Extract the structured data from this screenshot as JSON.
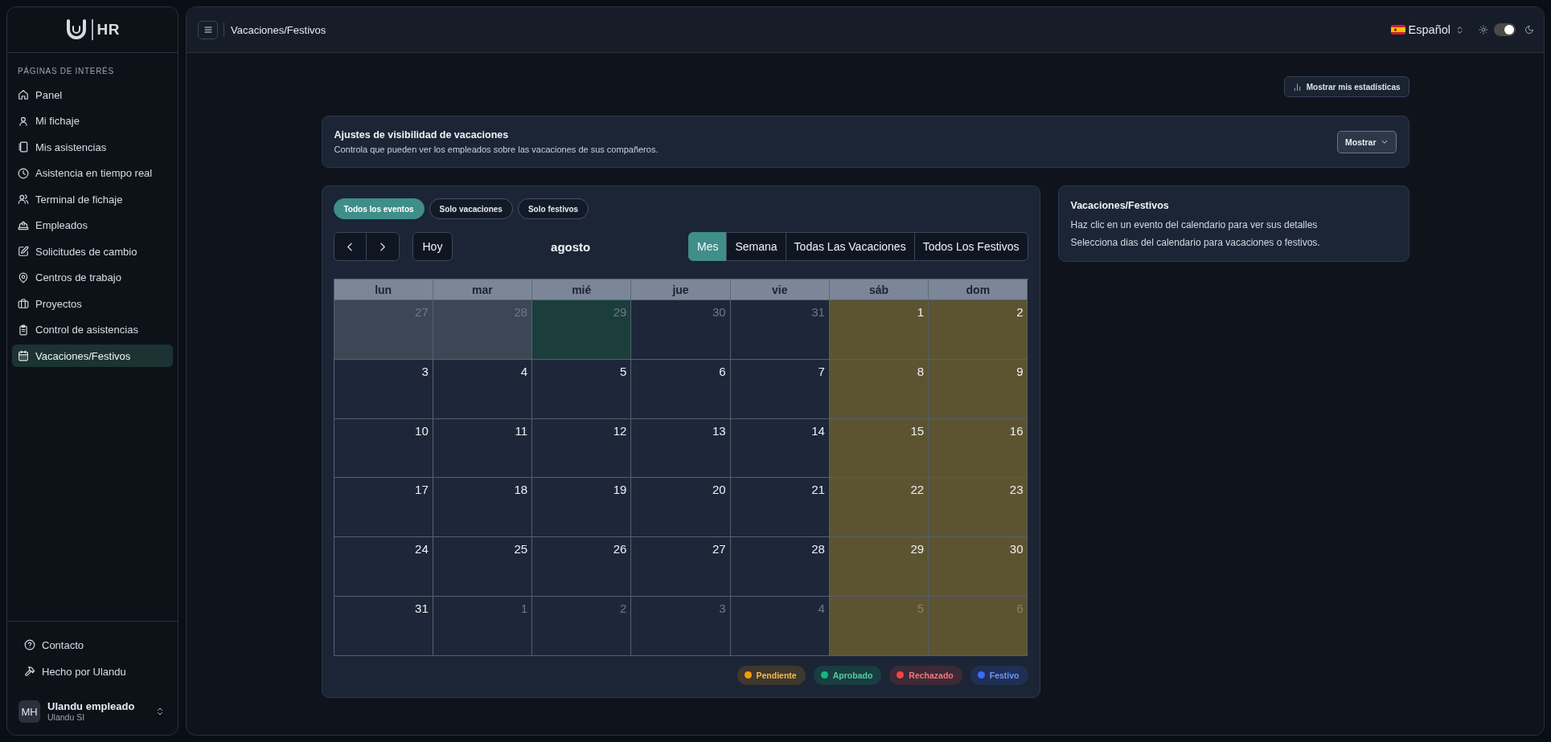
{
  "sidebar": {
    "logo_text": "HR",
    "section_label": "PÁGINAS DE INTERÉS",
    "items": [
      {
        "label": "Panel",
        "selected": false
      },
      {
        "label": "Mi fichaje",
        "selected": false
      },
      {
        "label": "Mis asistencias",
        "selected": false
      },
      {
        "label": "Asistencia en tiempo real",
        "selected": false
      },
      {
        "label": "Terminal de fichaje",
        "selected": false
      },
      {
        "label": "Empleados",
        "selected": false
      },
      {
        "label": "Solicitudes de cambio",
        "selected": false
      },
      {
        "label": "Centros de trabajo",
        "selected": false
      },
      {
        "label": "Proyectos",
        "selected": false
      },
      {
        "label": "Control de asistencias",
        "selected": false
      },
      {
        "label": "Vacaciones/Festivos",
        "selected": true
      }
    ],
    "footer_links": [
      {
        "label": "Contacto"
      },
      {
        "label": "Hecho por Ulandu"
      }
    ],
    "user": {
      "initials": "MH",
      "name": "Ulandu empleado",
      "company": "Ulandu SI"
    }
  },
  "header": {
    "title": "Vacaciones/Festivos",
    "language": "Español",
    "dark_mode": true
  },
  "stats_button": {
    "label": "Mostrar mis estadísticas"
  },
  "visibility_settings": {
    "title": "Ajustes de visibilidad de vacaciones",
    "description": "Controla que pueden ver los empleados sobre las vacaciones de sus compañeros.",
    "dropdown": "Mostrar"
  },
  "calendar": {
    "filters": [
      {
        "label": "Todos los eventos",
        "selected": true
      },
      {
        "label": "Solo vacaciones",
        "selected": false
      },
      {
        "label": "Solo festivos",
        "selected": false
      }
    ],
    "today_button": "Hoy",
    "month": "agosto",
    "views": [
      {
        "label": "Mes",
        "selected": true
      },
      {
        "label": "Semana",
        "selected": false
      },
      {
        "label": "Todas Las Vacaciones",
        "selected": false
      },
      {
        "label": "Todos Los Festivos",
        "selected": false
      }
    ],
    "weekdays": [
      "lun",
      "mar",
      "mié",
      "jue",
      "vie",
      "sáb",
      "dom"
    ],
    "weeks": [
      [
        {
          "day": "27",
          "kind": "shaded",
          "other_month": true
        },
        {
          "day": "28",
          "kind": "shaded",
          "other_month": true
        },
        {
          "day": "29",
          "kind": "highlight",
          "other_month": true
        },
        {
          "day": "30",
          "kind": "plain",
          "other_month": true
        },
        {
          "day": "31",
          "kind": "plain",
          "other_month": true
        },
        {
          "day": "1",
          "kind": "weekend",
          "other_month": false
        },
        {
          "day": "2",
          "kind": "weekend",
          "other_month": false
        }
      ],
      [
        {
          "day": "3",
          "kind": "plain",
          "other_month": false
        },
        {
          "day": "4",
          "kind": "plain",
          "other_month": false
        },
        {
          "day": "5",
          "kind": "plain",
          "other_month": false
        },
        {
          "day": "6",
          "kind": "plain",
          "other_month": false
        },
        {
          "day": "7",
          "kind": "plain",
          "other_month": false
        },
        {
          "day": "8",
          "kind": "weekend",
          "other_month": false
        },
        {
          "day": "9",
          "kind": "weekend",
          "other_month": false
        }
      ],
      [
        {
          "day": "10",
          "kind": "plain",
          "other_month": false
        },
        {
          "day": "11",
          "kind": "plain",
          "other_month": false
        },
        {
          "day": "12",
          "kind": "plain",
          "other_month": false
        },
        {
          "day": "13",
          "kind": "plain",
          "other_month": false
        },
        {
          "day": "14",
          "kind": "plain",
          "other_month": false
        },
        {
          "day": "15",
          "kind": "weekend",
          "other_month": false
        },
        {
          "day": "16",
          "kind": "weekend",
          "other_month": false
        }
      ],
      [
        {
          "day": "17",
          "kind": "plain",
          "other_month": false
        },
        {
          "day": "18",
          "kind": "plain",
          "other_month": false
        },
        {
          "day": "19",
          "kind": "plain",
          "other_month": false
        },
        {
          "day": "20",
          "kind": "plain",
          "other_month": false
        },
        {
          "day": "21",
          "kind": "plain",
          "other_month": false
        },
        {
          "day": "22",
          "kind": "weekend",
          "other_month": false
        },
        {
          "day": "23",
          "kind": "weekend",
          "other_month": false
        }
      ],
      [
        {
          "day": "24",
          "kind": "plain",
          "other_month": false
        },
        {
          "day": "25",
          "kind": "plain",
          "other_month": false
        },
        {
          "day": "26",
          "kind": "plain",
          "other_month": false
        },
        {
          "day": "27",
          "kind": "plain",
          "other_month": false
        },
        {
          "day": "28",
          "kind": "plain",
          "other_month": false
        },
        {
          "day": "29",
          "kind": "weekend",
          "other_month": false
        },
        {
          "day": "30",
          "kind": "weekend",
          "other_month": false
        }
      ],
      [
        {
          "day": "31",
          "kind": "plain",
          "other_month": false
        },
        {
          "day": "1",
          "kind": "plain",
          "other_month": true
        },
        {
          "day": "2",
          "kind": "plain",
          "other_month": true
        },
        {
          "day": "3",
          "kind": "plain",
          "other_month": true
        },
        {
          "day": "4",
          "kind": "plain",
          "other_month": true
        },
        {
          "day": "5",
          "kind": "weekend",
          "other_month": true
        },
        {
          "day": "6",
          "kind": "weekend",
          "other_month": true
        }
      ]
    ],
    "legend": [
      {
        "label": "Pendiente",
        "color": "#f59e0b"
      },
      {
        "label": "Aprobado",
        "color": "#10b981"
      },
      {
        "label": "Rechazado",
        "color": "#ef4444"
      },
      {
        "label": "Festivo",
        "color": "#3b6cf5"
      }
    ]
  },
  "info_card": {
    "title": "Vacaciones/Festivos",
    "lines": [
      "Haz clic en un evento del calendario para ver sus detalles",
      "Selecciona dias del calendario para vacaciones o festivos."
    ]
  }
}
